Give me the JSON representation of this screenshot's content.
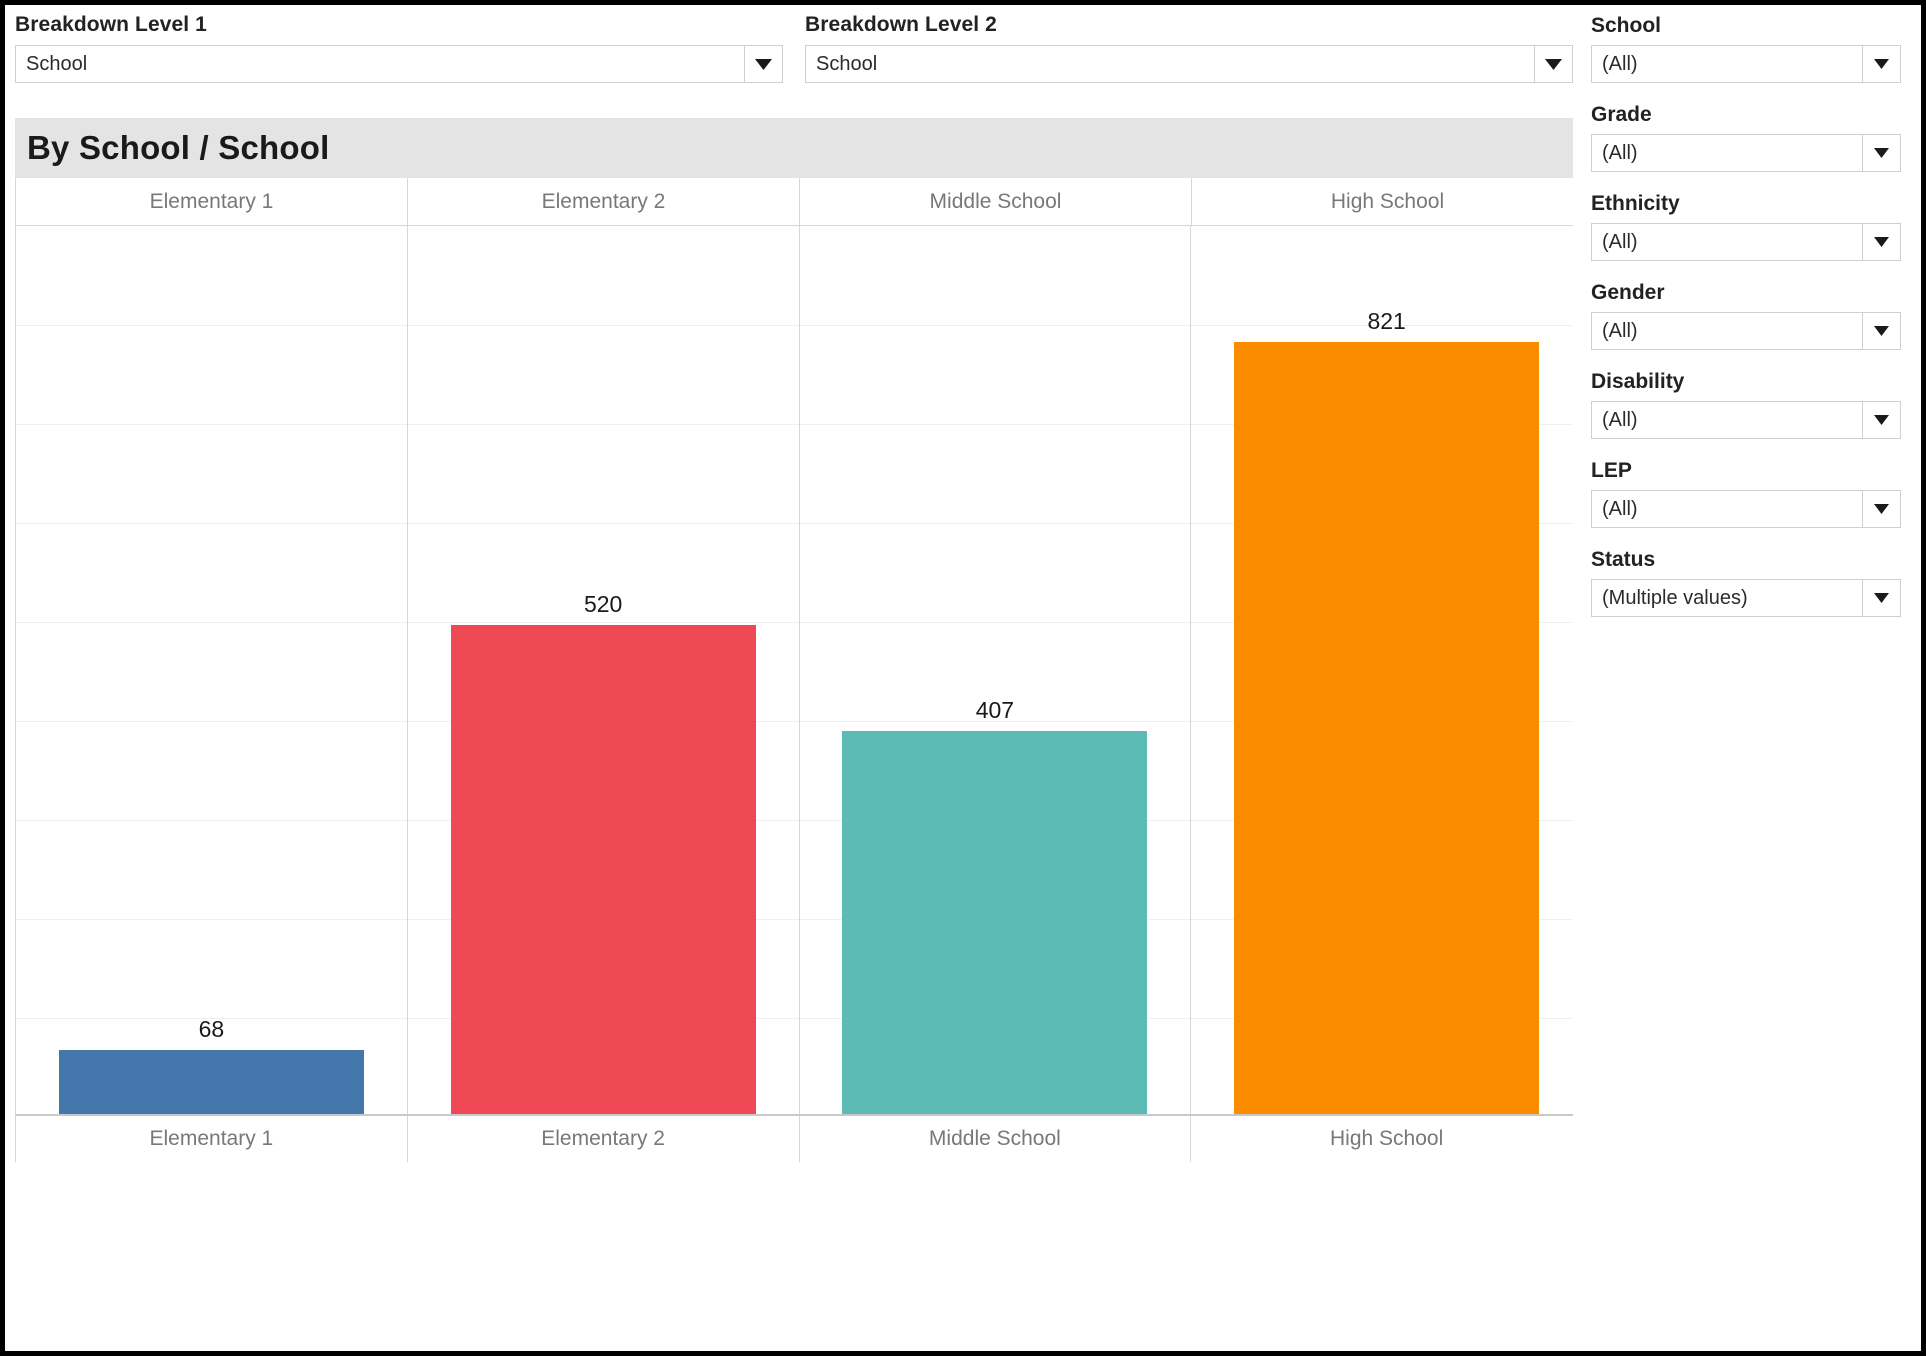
{
  "controls": [
    {
      "label": "Breakdown Level 1",
      "value": "School",
      "icon": "chevron-down-icon"
    },
    {
      "label": "Breakdown Level 2",
      "value": "School",
      "icon": "chevron-down-icon"
    }
  ],
  "chart_title": "By School / School",
  "filters": [
    {
      "label": "School",
      "value": "(All)"
    },
    {
      "label": "Grade",
      "value": "(All)"
    },
    {
      "label": "Ethnicity",
      "value": "(All)"
    },
    {
      "label": "Gender",
      "value": "(All)"
    },
    {
      "label": "Disability",
      "value": "(All)"
    },
    {
      "label": "LEP",
      "value": "(All)"
    },
    {
      "label": "Status",
      "value": "(Multiple values)"
    }
  ],
  "colors": {
    "blue": "#4478AC",
    "red": "#EF4955",
    "teal": "#5CBBB4",
    "orange": "#FB8C00",
    "title_bar": "#e4e4e4",
    "gridline": "#f0f0f0",
    "divider": "#d7d7d7"
  },
  "chart_data": {
    "type": "bar",
    "title": "By School / School",
    "xlabel": "",
    "ylabel": "",
    "grid": true,
    "legend": "none",
    "ylim": [
      0,
      900
    ],
    "categories": [
      "Elementary 1",
      "Elementary 2",
      "Middle School",
      "High School"
    ],
    "values": [
      68,
      520,
      407,
      821
    ],
    "data_labels": [
      "68",
      "520",
      "407",
      "821"
    ],
    "colors": [
      "#4478AC",
      "#EF4955",
      "#5CBBB4",
      "#FB8C00"
    ],
    "column_headers": [
      "Elementary 1",
      "Elementary 2",
      "Middle School",
      "High School"
    ],
    "axis_tick_labels": [
      "Elementary 1",
      "Elementary 2",
      "Middle School",
      "High School"
    ]
  }
}
